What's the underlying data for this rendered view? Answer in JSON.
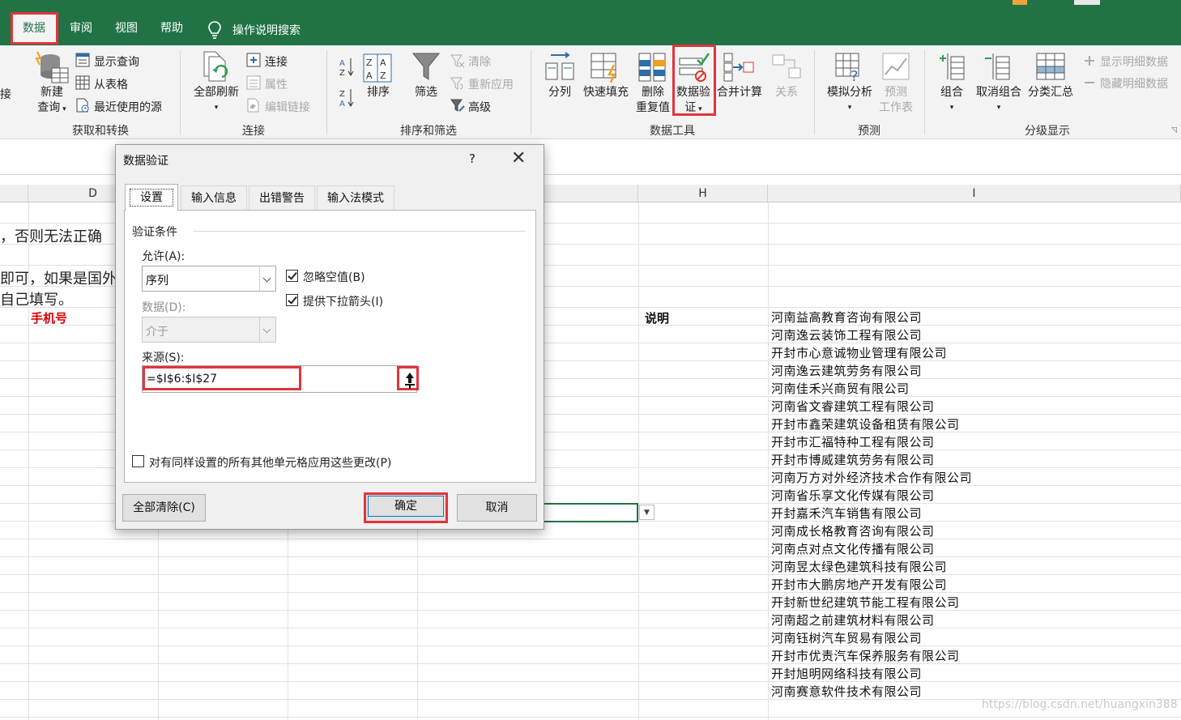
{
  "ribbon": {
    "tabs": [
      "数据",
      "审阅",
      "视图",
      "帮助"
    ],
    "active_tab": "数据",
    "tell_me": "操作说明搜索",
    "groups": {
      "get_transform": {
        "label": "获取和转换",
        "clipped_left": "接",
        "new_query": [
          "新建",
          "查询"
        ],
        "show_queries": "显示查询",
        "from_table": "从表格",
        "recent_sources": "最近使用的源"
      },
      "connections": {
        "label": "连接",
        "refresh_all": "全部刷新",
        "connections": "连接",
        "properties": "属性",
        "edit_links": "编辑链接"
      },
      "sort_filter": {
        "label": "排序和筛选",
        "sort": "排序",
        "filter": "筛选",
        "clear": "清除",
        "reapply": "重新应用",
        "advanced": "高级"
      },
      "data_tools": {
        "label": "数据工具",
        "text_to_columns": "分列",
        "flash_fill": "快速填充",
        "remove_duplicates": [
          "删除",
          "重复值"
        ],
        "data_validation": [
          "数据验",
          "证"
        ],
        "consolidate": "合并计算",
        "relationships": "关系"
      },
      "forecast": {
        "label": "预测",
        "what_if": "模拟分析",
        "forecast_sheet": [
          "预测",
          "工作表"
        ]
      },
      "outline": {
        "label": "分级显示",
        "group": "组合",
        "ungroup": "取消组合",
        "subtotal": "分类汇总",
        "show_detail": "显示明细数据",
        "hide_detail": "隐藏明细数据"
      }
    },
    "colors": {
      "excel_green": "#217346",
      "highlight_red": "#e0353b"
    }
  },
  "sheet": {
    "columns": [
      "D",
      "H",
      "I"
    ],
    "text_fragments": [
      "，否则无法正确",
      "即可，如果是国外",
      "自己填写。"
    ],
    "phone_header": "手机号",
    "note_header": "说明",
    "companies": [
      "河南益高教育咨询有限公司",
      "河南逸云装饰工程有限公司",
      "开封市心意诚物业管理有限公司",
      "河南逸云建筑劳务有限公司",
      "河南佳禾兴商贸有限公司",
      "河南省文睿建筑工程有限公司",
      "开封市鑫荣建筑设备租赁有限公司",
      "开封市汇福特种工程有限公司",
      "开封市博威建筑劳务有限公司",
      "河南万方对外经济技术合作有限公司",
      "河南省乐享文化传媒有限公司",
      "开封嘉禾汽车销售有限公司",
      "河南成长格教育咨询有限公司",
      "河南点对点文化传播有限公司",
      "河南昱太绿色建筑科技有限公司",
      "开封市大鹏房地产开发有限公司",
      "开封新世纪建筑节能工程有限公司",
      "河南超之前建筑材料有限公司",
      "河南钰树汽车贸易有限公司",
      "开封市优责汽车保养服务有限公司",
      "开封旭明网络科技有限公司",
      "河南赛意软件技术有限公司"
    ],
    "watermark": "https://blog.csdn.net/huangxin388"
  },
  "dialog": {
    "title": "数据验证",
    "help": "?",
    "close": "✕",
    "tabs": [
      "设置",
      "输入信息",
      "出错警告",
      "输入法模式"
    ],
    "active_tab": "设置",
    "section": "验证条件",
    "allow_label": "允许(A):",
    "allow_value": "序列",
    "ignore_blank": {
      "label": "忽略空值(B)",
      "checked": true
    },
    "dropdown_arrow": {
      "label": "提供下拉箭头(I)",
      "checked": true
    },
    "data_label": "数据(D):",
    "data_value": "介于",
    "source_label": "来源(S):",
    "source_value": "=$I$6:$I$27",
    "apply_all": {
      "label": "对有同样设置的所有其他单元格应用这些更改(P)",
      "checked": false
    },
    "clear_all": "全部清除(C)",
    "ok": "确定",
    "cancel": "取消"
  }
}
